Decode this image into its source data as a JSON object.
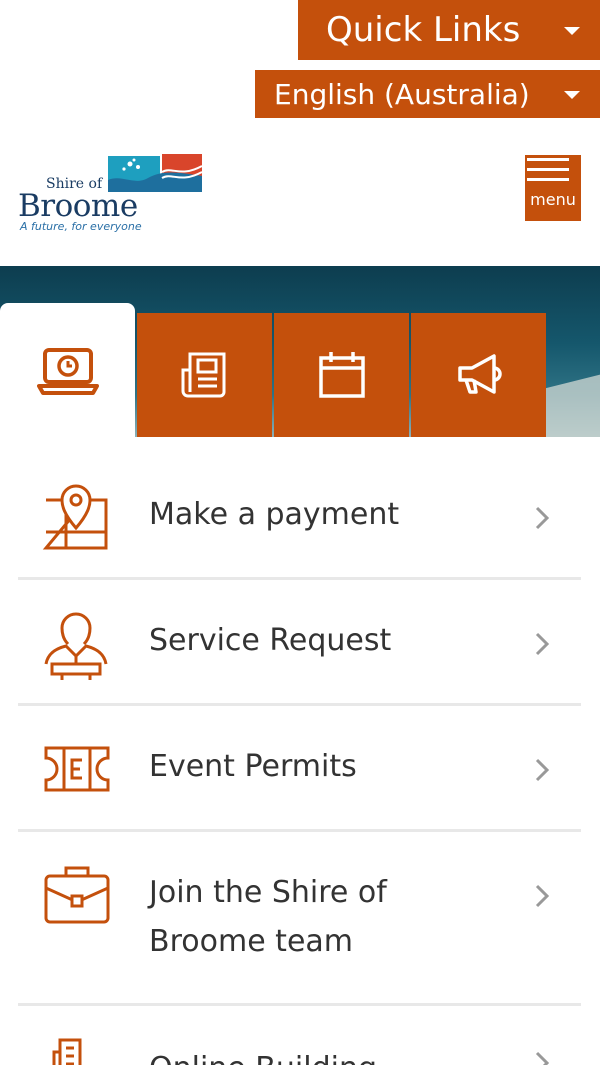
{
  "header": {
    "quick_links_label": "Quick Links",
    "language_label": "English (Australia)",
    "menu_label": "menu"
  },
  "logo": {
    "line1": "Shire of",
    "line2": "Broome",
    "tagline": "A future, for everyone"
  },
  "tabs": [
    {
      "icon": "laptop-clock-icon",
      "active": true
    },
    {
      "icon": "newspaper-icon",
      "active": false
    },
    {
      "icon": "calendar-icon",
      "active": false
    },
    {
      "icon": "megaphone-icon",
      "active": false
    }
  ],
  "services": [
    {
      "label": "Make a payment",
      "icon": "map-pin-icon"
    },
    {
      "label": "Service Request",
      "icon": "person-podium-icon"
    },
    {
      "label": "Event Permits",
      "icon": "ticket-icon"
    },
    {
      "label_line1": "Join the Shire of",
      "label_line2": "Broome team",
      "icon": "briefcase-icon"
    },
    {
      "label": "Online Building",
      "icon": "building-icon"
    }
  ],
  "colors": {
    "accent": "#c4500c",
    "divider": "#e8e8e8",
    "text": "#333333",
    "chevron": "#999999"
  }
}
